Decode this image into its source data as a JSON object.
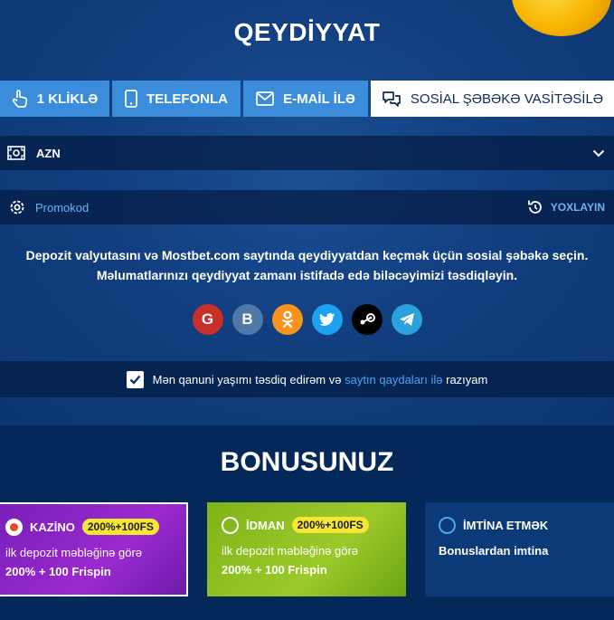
{
  "header": {
    "title": "QEYDİYYAT"
  },
  "tabs": [
    {
      "label": "1 KLİKLƏ",
      "icon": "hand-pointer-icon"
    },
    {
      "label": "TELEFONLA",
      "icon": "phone-icon"
    },
    {
      "label": "E-MAİL İLƏ",
      "icon": "envelope-icon"
    },
    {
      "label": "SOSİAL ŞƏBƏKƏ VASİTƏSİLƏ",
      "icon": "chat-bubbles-icon",
      "active": true
    }
  ],
  "currency": {
    "value": "AZN",
    "icon": "money-icon"
  },
  "promo": {
    "label": "Promokod",
    "action": "YOXLAYIN"
  },
  "info": {
    "line1": "Depozit valyutasını və Mostbet.com saytında qeydiyyatdan keçmək üçün sosial şəbəkə seçin.",
    "line2": "Məlumatlarınızı qeydiyyat zamanı istifadə edə biləcəyimizi təsdiqləyin."
  },
  "socials": [
    {
      "name": "google",
      "glyph": "G",
      "color": "#c9302c"
    },
    {
      "name": "vkontakte",
      "glyph": "B",
      "color": "#5179a8"
    },
    {
      "name": "odnoklassniki",
      "glyph": "ok",
      "color": "#f7931e"
    },
    {
      "name": "twitter",
      "glyph": "tw",
      "color": "#1da1f2"
    },
    {
      "name": "steam",
      "glyph": "st",
      "color": "#000000"
    },
    {
      "name": "telegram",
      "glyph": "tg",
      "color": "#2aa3dd"
    }
  ],
  "agreement": {
    "before": "Mən qanuni yaşımı təsdiq edirəm və ",
    "link": "saytın qaydaları ilə",
    "after": " razıyam",
    "checked": true
  },
  "bonus": {
    "title": "BONUSUNUZ",
    "cards": [
      {
        "name": "KAZİNO",
        "pill": "200%+100FS",
        "line1": "ilk depozit məbləğinə görə",
        "line2": "200% + 100 Frispin",
        "selected": true
      },
      {
        "name": "İDMAN",
        "pill": "200%+100FS",
        "line1": "ilk depozit məbləğinə görə",
        "line2": "200% + 100 Frispin",
        "selected": false
      },
      {
        "name": "İMTİNA ETMƏK",
        "line1": "Bonuslardan imtina",
        "selected": false
      }
    ]
  },
  "colors": {
    "accent": "#3b8cdb",
    "link": "#4ea3f2",
    "pill": "#f5e633"
  }
}
